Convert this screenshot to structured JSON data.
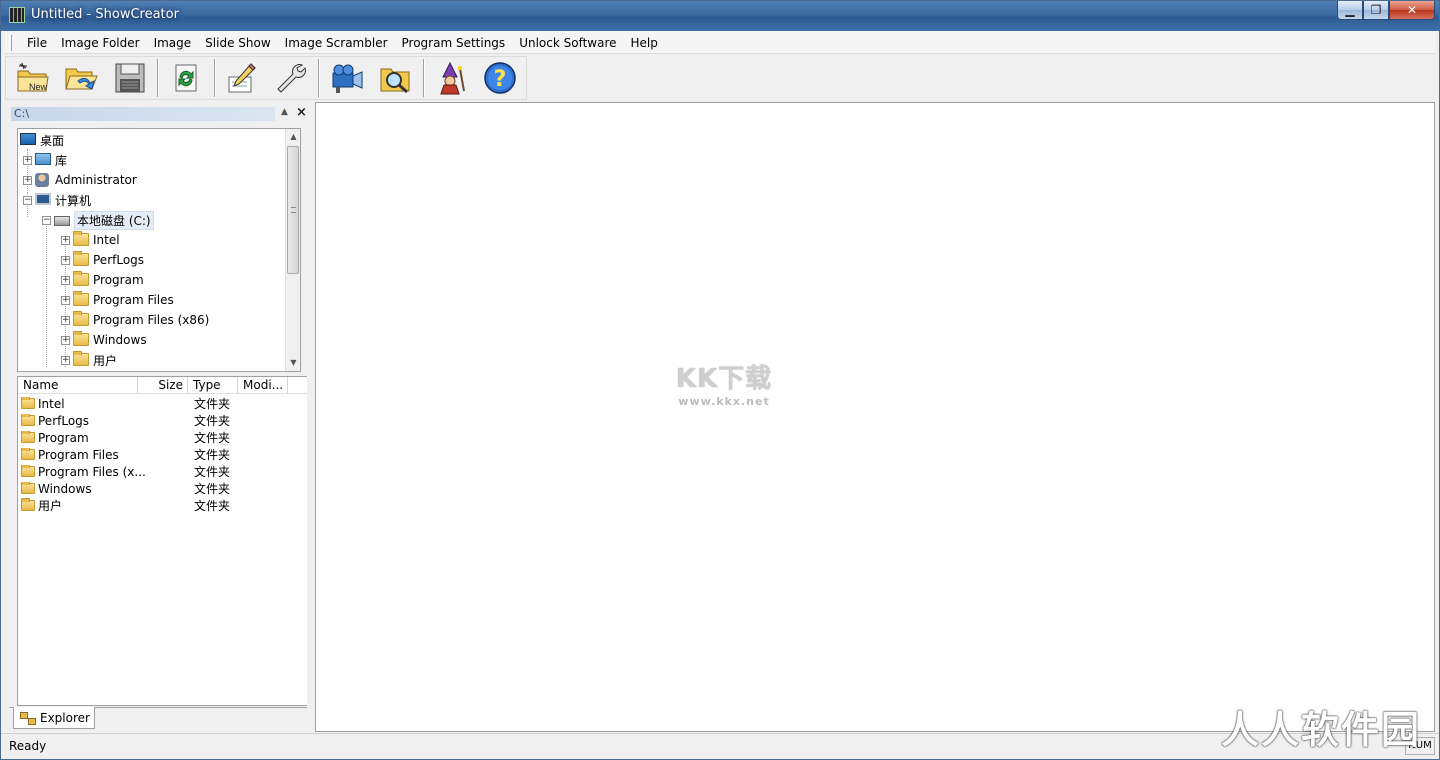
{
  "window": {
    "title": "Untitled - ShowCreator"
  },
  "caption": {
    "minimize": "▁",
    "maximize": "❐",
    "close": "✕"
  },
  "menu": [
    "File",
    "Image Folder",
    "Image",
    "Slide Show",
    "Image Scrambler",
    "Program Settings",
    "Unlock Software",
    "Help"
  ],
  "toolbar": {
    "new_label": "New",
    "buttons": [
      "new-show",
      "open-show",
      "save-show",
      "refresh",
      "edit",
      "settings",
      "projector",
      "browse-folder",
      "wizard",
      "help"
    ]
  },
  "panel": {
    "path": "C:\\",
    "up": "▲",
    "close": "×"
  },
  "tree": {
    "items": [
      {
        "label": "桌面",
        "icon": "desktop-icon"
      },
      {
        "label": "库",
        "icon": "library-icon"
      },
      {
        "label": "Administrator",
        "icon": "user-icon"
      },
      {
        "label": "计算机",
        "icon": "computer-icon"
      },
      {
        "label": "本地磁盘 (C:)",
        "icon": "drive-icon"
      },
      {
        "label": "Intel",
        "icon": "folder-icon"
      },
      {
        "label": "PerfLogs",
        "icon": "folder-icon"
      },
      {
        "label": "Program",
        "icon": "folder-icon"
      },
      {
        "label": "Program Files",
        "icon": "folder-icon"
      },
      {
        "label": "Program Files (x86)",
        "icon": "folder-icon"
      },
      {
        "label": "Windows",
        "icon": "folder-icon"
      },
      {
        "label": "用户",
        "icon": "folder-icon"
      }
    ],
    "expand_plus": "+",
    "expand_minus": "−"
  },
  "filelist": {
    "columns": [
      "Name",
      "Size",
      "Type",
      "Modi..."
    ],
    "rows": [
      {
        "name": "Intel",
        "type": "文件夹"
      },
      {
        "name": "PerfLogs",
        "type": "文件夹"
      },
      {
        "name": "Program",
        "type": "文件夹"
      },
      {
        "name": "Program Files",
        "type": "文件夹"
      },
      {
        "name": "Program Files (x...",
        "type": "文件夹"
      },
      {
        "name": "Windows",
        "type": "文件夹"
      },
      {
        "name": "用户",
        "type": "文件夹"
      }
    ]
  },
  "tabs": {
    "explorer": "Explorer"
  },
  "watermark": {
    "big": "KK下载",
    "small": "www.kkx.net"
  },
  "status": {
    "text": "Ready",
    "num": "NUM",
    "corner": "人人软件园"
  },
  "colors": {
    "titlebar": "#3c6aa0",
    "folder": "#e8b94a",
    "selection": "#e5eef8"
  }
}
